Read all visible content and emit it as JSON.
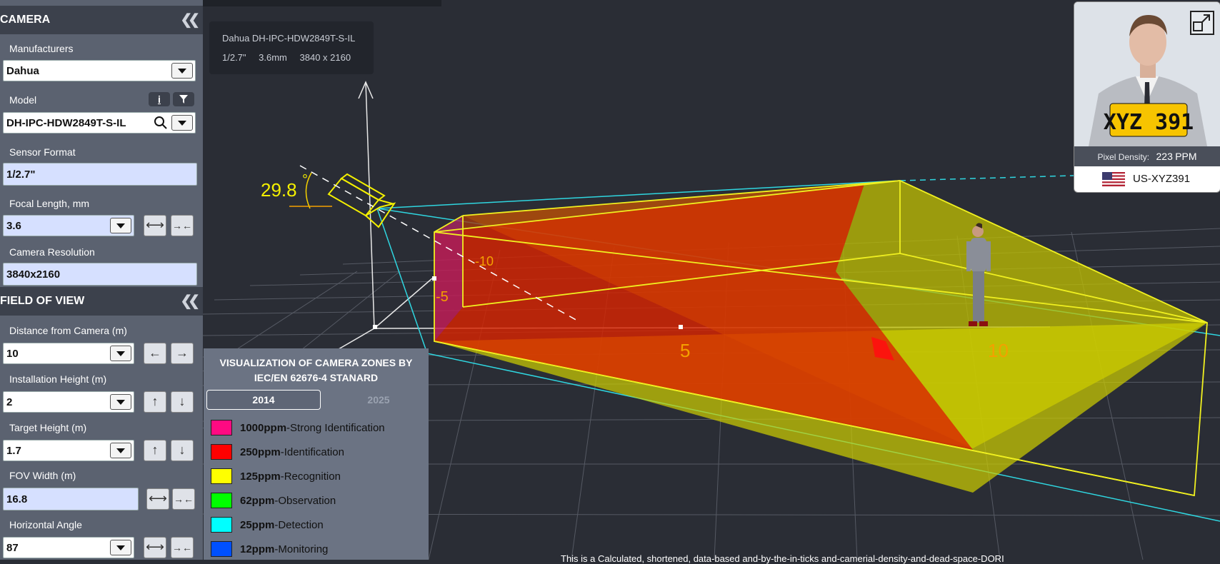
{
  "camera_section": {
    "title": "CAMERA",
    "collapse_icon": "double-chevron-left-icon"
  },
  "manufacturers": {
    "label": "Manufacturers",
    "value": "Dahua"
  },
  "model": {
    "label": "Model",
    "value": "DH-IPC-HDW2849T-S-IL",
    "info_icon": "i",
    "filter_icon": "filter-icon"
  },
  "sensor_format": {
    "label": "Sensor Format",
    "value": "1/2.7\""
  },
  "focal_length": {
    "label": "Focal Length, mm",
    "value": "3.6"
  },
  "camera_resolution": {
    "label": "Camera Resolution",
    "value": "3840x2160"
  },
  "fov_section": {
    "title": "FIELD OF VIEW"
  },
  "distance": {
    "label": "Distance from Camera (m)",
    "value": "10"
  },
  "installation_height": {
    "label": "Installation Height (m)",
    "value": "2"
  },
  "target_height": {
    "label": "Target Height (m)",
    "value": "1.7"
  },
  "fov_width": {
    "label": "FOV Width (m)",
    "value": "16.8"
  },
  "horizontal_angle": {
    "label": "Horizontal Angle",
    "value": "87"
  },
  "info_box": {
    "model": "Dahua DH-IPC-HDW2849T-S-IL",
    "sensor": "1/2.7\"",
    "focal": "3.6mm",
    "resolution": "3840 x 2160"
  },
  "scene": {
    "tilt_angle": "29.8",
    "degree_symbol": "°",
    "axis_neg10": "-10",
    "axis_neg5": "-5",
    "axis_5": "5",
    "axis_10": "10"
  },
  "zones": {
    "title_line1": "VISUALIZATION OF CAMERA ZONES BY",
    "title_line2": "IEC/EN 62676-4 STANARD",
    "tab_2014": "2014",
    "tab_2025": "2025",
    "items": [
      {
        "ppm": "1000ppm",
        "name": "-Strong Identification",
        "color": "#ff0a82"
      },
      {
        "ppm": "250ppm",
        "name": "-Identification",
        "color": "#ff0000"
      },
      {
        "ppm": "125ppm",
        "name": "-Recognition",
        "color": "#ffff00"
      },
      {
        "ppm": "62ppm",
        "name": "-Observation",
        "color": "#00ff00"
      },
      {
        "ppm": "25ppm",
        "name": "-Detection",
        "color": "#00ffff"
      },
      {
        "ppm": "12ppm",
        "name": "-Monitoring",
        "color": "#0050ff"
      }
    ]
  },
  "pixel_card": {
    "density_label": "Pixel Density:",
    "density_value": "223",
    "density_unit": "PPM",
    "plate_text": "XYZ 391",
    "plate_id": "US-XYZ391",
    "expand_icon": "expand-icon"
  },
  "footer_text": "This is a Calculated, shortened, data-based and-by-the-in-ticks and-camerial-density-and-dead-space-DORI"
}
